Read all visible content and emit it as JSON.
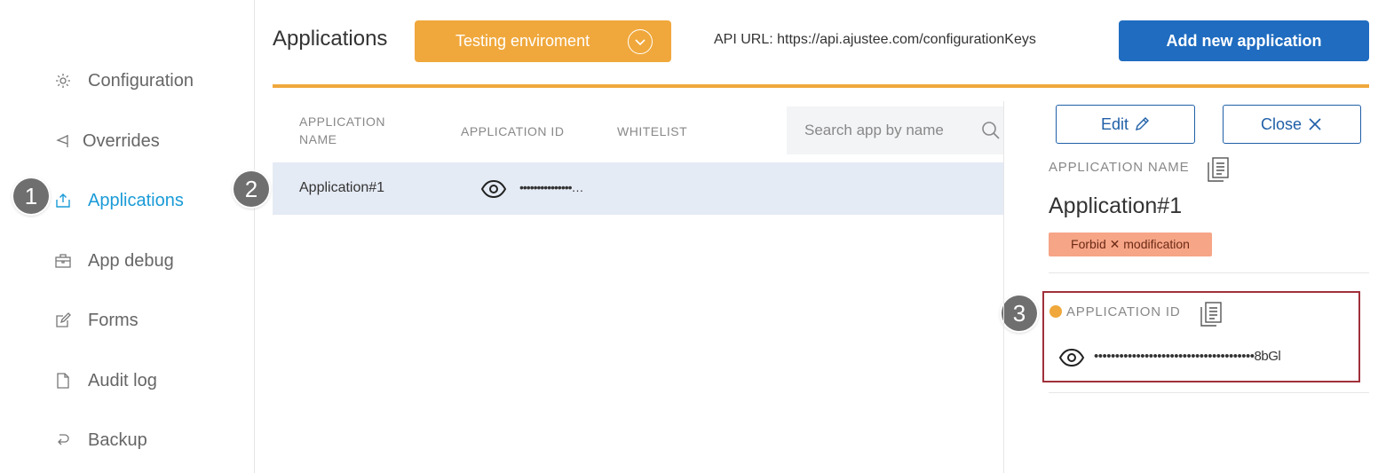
{
  "sidebar": {
    "items": [
      {
        "label": "Configuration",
        "icon": "gear-icon"
      },
      {
        "label": "Overrides",
        "icon": "flag-icon"
      },
      {
        "label": "Applications",
        "icon": "share-icon",
        "active": true
      },
      {
        "label": "App debug",
        "icon": "briefcase-icon"
      },
      {
        "label": "Forms",
        "icon": "edit-icon"
      },
      {
        "label": "Audit log",
        "icon": "document-icon"
      },
      {
        "label": "Backup",
        "icon": "restore-icon"
      }
    ]
  },
  "steps": [
    "1",
    "2",
    "3"
  ],
  "header": {
    "title": "Applications",
    "env_label": "Testing enviroment",
    "api_url": "API URL: https://api.ajustee.com/configurationKeys",
    "add_button": "Add new application"
  },
  "table": {
    "columns": [
      "APPLICATION NAME",
      "APPLICATION ID",
      "WHITELIST"
    ],
    "search_placeholder": "Search app by name",
    "rows": [
      {
        "name": "Application#1",
        "app_id_masked": "•••••••••••••••…"
      }
    ]
  },
  "detail": {
    "edit_label": "Edit",
    "close_label": "Close",
    "app_name_label": "APPLICATION NAME",
    "app_name": "Application#1",
    "forbid_label": "Forbid ✕ modification",
    "app_id_label": "APPLICATION ID",
    "app_id_masked": "••••••••••••••••••••••••••••••••••••••8bGl"
  },
  "colors": {
    "accent_orange": "#f0a83c",
    "primary_blue": "#1f6cc0",
    "active_nav": "#1a9bd7",
    "forbid_bg": "#f7a587",
    "highlight_border": "#a0303a"
  }
}
